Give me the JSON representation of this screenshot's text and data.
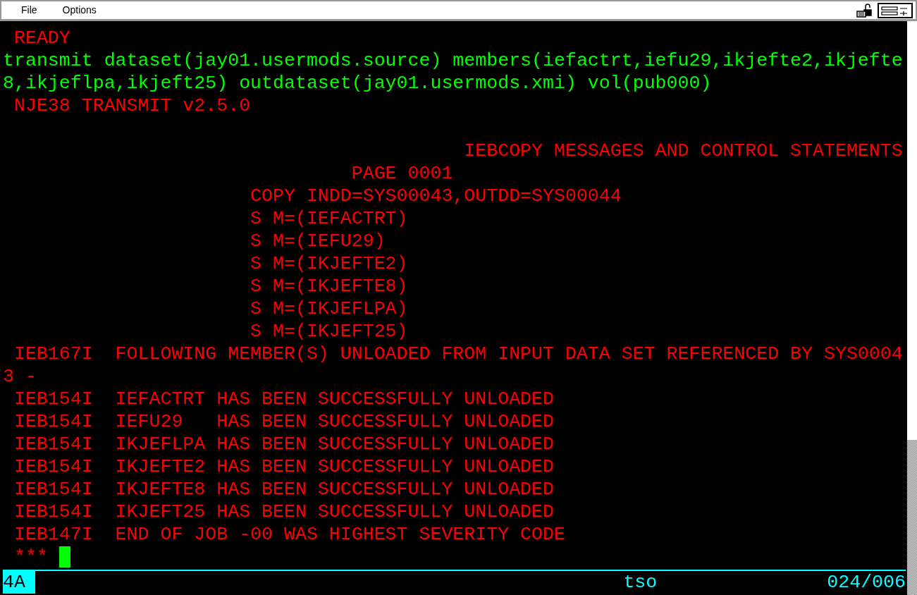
{
  "menu": [
    {
      "label": "File"
    },
    {
      "label": "Options"
    }
  ],
  "lines": [
    {
      "text": " READY",
      "color": "#ff0000"
    },
    {
      "text": "transmit dataset(jay01.usermods.source) members(iefactrt,iefu29,ikjefte2,ikjefte",
      "color": "#00ff00"
    },
    {
      "text": "8,ikjeflpa,ikjeft25) outdataset(jay01.usermods.xmi) vol(pub000)",
      "color": "#00ff00"
    },
    {
      "text": " NJE38 TRANSMIT v2.5.0",
      "color": "#ff0000"
    },
    {
      "kind": "blank"
    },
    {
      "text": "                                         IEBCOPY MESSAGES AND CONTROL STATEMENTS",
      "color": "#ff0000"
    },
    {
      "text": "                               PAGE 0001",
      "color": "#ff0000"
    },
    {
      "text": "                      COPY INDD=SYS00043,OUTDD=SYS00044",
      "color": "#ff0000"
    },
    {
      "text": "                      S M=(IEFACTRT)",
      "color": "#ff0000"
    },
    {
      "text": "                      S M=(IEFU29)",
      "color": "#ff0000"
    },
    {
      "text": "                      S M=(IKJEFTE2)",
      "color": "#ff0000"
    },
    {
      "text": "                      S M=(IKJEFTE8)",
      "color": "#ff0000"
    },
    {
      "text": "                      S M=(IKJEFLPA)",
      "color": "#ff0000"
    },
    {
      "text": "                      S M=(IKJEFT25)",
      "color": "#ff0000"
    },
    {
      "text": " IEB167I  FOLLOWING MEMBER(S) UNLOADED FROM INPUT DATA SET REFERENCED BY SYS0004",
      "color": "#ff0000"
    },
    {
      "text": "3 -",
      "color": "#ff0000"
    },
    {
      "text": " IEB154I  IEFACTRT HAS BEEN SUCCESSFULLY UNLOADED",
      "color": "#ff0000"
    },
    {
      "text": " IEB154I  IEFU29   HAS BEEN SUCCESSFULLY UNLOADED",
      "color": "#ff0000"
    },
    {
      "text": " IEB154I  IKJEFLPA HAS BEEN SUCCESSFULLY UNLOADED",
      "color": "#ff0000"
    },
    {
      "text": " IEB154I  IKJEFTE2 HAS BEEN SUCCESSFULLY UNLOADED",
      "color": "#ff0000"
    },
    {
      "text": " IEB154I  IKJEFTE8 HAS BEEN SUCCESSFULLY UNLOADED",
      "color": "#ff0000"
    },
    {
      "text": " IEB154I  IKJEFT25 HAS BEEN SUCCESSFULLY UNLOADED",
      "color": "#ff0000"
    },
    {
      "text": " IEB147I  END OF JOB -00 WAS HIGHEST SEVERITY CODE",
      "color": "#ff0000"
    }
  ],
  "input_line": {
    "text": " ***",
    "color": "#ff0000",
    "cursor": true
  },
  "status_bar": {
    "indicator": "4A",
    "system": "tso",
    "cursor_position": "024/006"
  }
}
